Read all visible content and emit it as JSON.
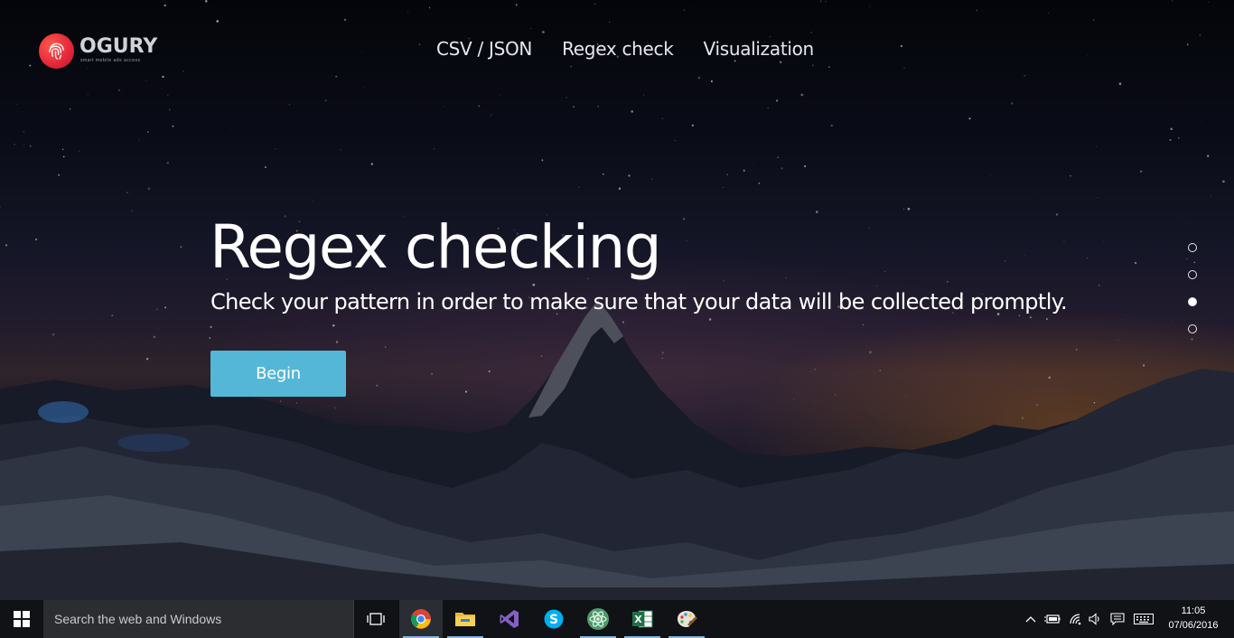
{
  "logo": {
    "name": "OGURY",
    "tagline": "smart mobile ads access"
  },
  "nav": [
    {
      "label": "CSV / JSON"
    },
    {
      "label": "Regex check"
    },
    {
      "label": "Visualization"
    }
  ],
  "hero": {
    "title": "Regex checking",
    "subtitle": "Check your pattern in order to make sure that your data will be collected promptly.",
    "button_label": "Begin"
  },
  "pagination": {
    "total": 4,
    "active_index": 3
  },
  "taskbar": {
    "search_placeholder": "Search the web and Windows",
    "apps": [
      {
        "icon": "task-view-icon"
      },
      {
        "icon": "chrome-icon",
        "running": true,
        "active": true
      },
      {
        "icon": "file-explorer-icon",
        "running": true
      },
      {
        "icon": "visual-studio-icon"
      },
      {
        "icon": "skype-icon"
      },
      {
        "icon": "atom-icon",
        "running": true
      },
      {
        "icon": "excel-icon",
        "running": true
      },
      {
        "icon": "paint-icon",
        "running": true
      }
    ],
    "clock": {
      "time": "11:05",
      "date": "07/06/2016"
    }
  },
  "colors": {
    "accent_button": "#55b7d7",
    "logo_red": "#e3263a",
    "taskbar": "#101216"
  }
}
